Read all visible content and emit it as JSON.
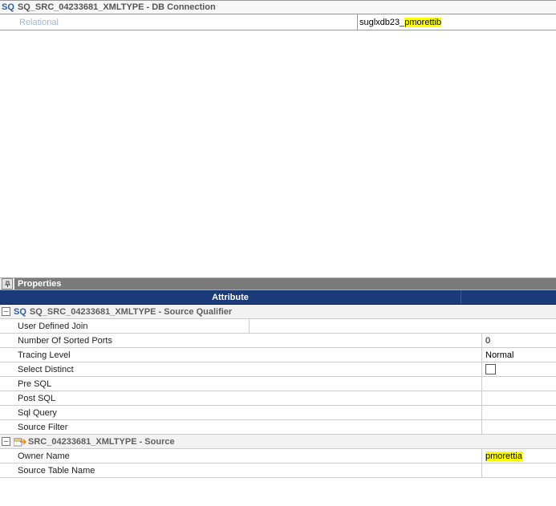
{
  "top": {
    "sq_badge": "SQ",
    "title": "SQ_SRC_04233681_XMLTYPE - DB Connection",
    "row_label": "Relational",
    "conn_prefix": "suglxdb23_",
    "conn_highlight": "pmorettib"
  },
  "properties": {
    "panel_label": "Properties",
    "attr_header": "Attribute",
    "val_header": ""
  },
  "group_sq": {
    "toggle": "–",
    "badge": "SQ",
    "title": "SQ_SRC_04233681_XMLTYPE - Source Qualifier",
    "rows": [
      {
        "name": "User Defined Join",
        "value": ""
      },
      {
        "name": "Number Of Sorted Ports",
        "value": "0"
      },
      {
        "name": "Tracing Level",
        "value": "Normal"
      },
      {
        "name": "Select Distinct",
        "value": "checkbox"
      },
      {
        "name": "Pre SQL",
        "value": ""
      },
      {
        "name": "Post SQL",
        "value": ""
      },
      {
        "name": "Sql Query",
        "value": ""
      },
      {
        "name": "Source Filter",
        "value": ""
      }
    ]
  },
  "group_src": {
    "toggle": "–",
    "title": "SRC_04233681_XMLTYPE - Source",
    "rows": [
      {
        "name": "Owner Name",
        "highlight": "pmorettia"
      },
      {
        "name": "Source Table Name",
        "value": ""
      }
    ]
  }
}
